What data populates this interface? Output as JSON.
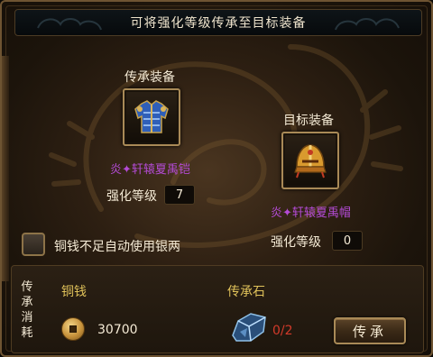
{
  "dialog": {
    "title": "可将强化等级传承至目标装备"
  },
  "source": {
    "heading": "传承装备",
    "item_name": "炎✦轩辕夏禹铠",
    "icon": "blue-armor-icon",
    "level_label": "强化等级",
    "level_value": "7"
  },
  "target": {
    "heading": "目标装备",
    "item_name": "炎✦轩辕夏禹帽",
    "icon": "gold-helmet-icon",
    "level_label": "强化等级",
    "level_value": "0"
  },
  "option": {
    "checkbox_label": "铜钱不足自动使用银两",
    "checked": false
  },
  "cost": {
    "section_label": "传承消耗",
    "copper_label": "铜钱",
    "copper_amount": "30700",
    "copper_icon": "copper-coin-icon",
    "stone_label": "传承石",
    "stone_count": "0/2",
    "stone_icon": "inheritance-stone-icon"
  },
  "actions": {
    "inherit_button": "传承"
  },
  "colors": {
    "item_name": "#b44bd6",
    "cost_header": "#e0c25a",
    "insufficient": "#d23a2a",
    "frame_gold": "#a98a57"
  }
}
